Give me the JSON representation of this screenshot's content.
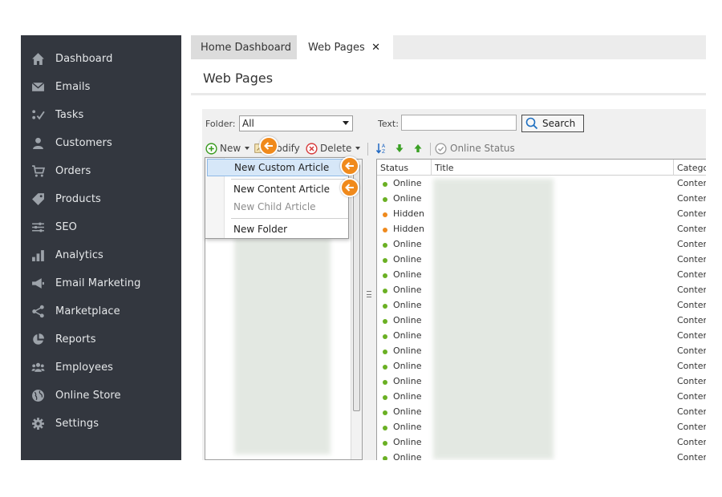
{
  "sidebar": {
    "items": [
      {
        "label": "Dashboard",
        "icon": "home-icon"
      },
      {
        "label": "Emails",
        "icon": "envelope-icon"
      },
      {
        "label": "Tasks",
        "icon": "tasks-icon"
      },
      {
        "label": "Customers",
        "icon": "user-icon"
      },
      {
        "label": "Orders",
        "icon": "cart-icon"
      },
      {
        "label": "Products",
        "icon": "tag-icon"
      },
      {
        "label": "SEO",
        "icon": "sliders-icon"
      },
      {
        "label": "Analytics",
        "icon": "bar-chart-icon"
      },
      {
        "label": "Email Marketing",
        "icon": "megaphone-icon"
      },
      {
        "label": "Marketplace",
        "icon": "share-icon"
      },
      {
        "label": "Reports",
        "icon": "pie-chart-icon"
      },
      {
        "label": "Employees",
        "icon": "group-icon"
      },
      {
        "label": "Online Store",
        "icon": "globe-icon"
      },
      {
        "label": "Settings",
        "icon": "gear-icon"
      }
    ]
  },
  "tabs": [
    {
      "label": "Home Dashboard"
    },
    {
      "label": "Web Pages"
    }
  ],
  "page_title": "Web Pages",
  "filter": {
    "folder_label": "Folder:",
    "folder_value": "All",
    "text_label": "Text:",
    "text_value": "",
    "search_label": "Search"
  },
  "toolbar": {
    "new_label": "New",
    "modify_label": "Modify",
    "delete_label": "Delete",
    "online_status_label": "Online Status"
  },
  "new_menu": {
    "items": [
      "New Custom Article",
      "New Content Article",
      "New Child Article",
      "New Folder"
    ]
  },
  "grid": {
    "columns": [
      "Status",
      "Title",
      "Category"
    ],
    "rows": [
      {
        "status": "Online",
        "category": "Content"
      },
      {
        "status": "Online",
        "category": "Content"
      },
      {
        "status": "Hidden",
        "category": "Content"
      },
      {
        "status": "Hidden",
        "category": "Content"
      },
      {
        "status": "Online",
        "category": "Content"
      },
      {
        "status": "Online",
        "category": "Content"
      },
      {
        "status": "Online",
        "category": "Content"
      },
      {
        "status": "Online",
        "category": "Content"
      },
      {
        "status": "Online",
        "category": "Content"
      },
      {
        "status": "Online",
        "category": "Content"
      },
      {
        "status": "Online",
        "category": "Content"
      },
      {
        "status": "Online",
        "category": "Content"
      },
      {
        "status": "Online",
        "category": "Content"
      },
      {
        "status": "Online",
        "category": "Content"
      },
      {
        "status": "Online",
        "category": "Content"
      },
      {
        "status": "Online",
        "category": "Content"
      },
      {
        "status": "Online",
        "category": "Content"
      },
      {
        "status": "Online",
        "category": "Content"
      },
      {
        "status": "Online",
        "category": "Content"
      }
    ]
  },
  "colors": {
    "sidebar_bg": "#33373f",
    "online": "#6ab023",
    "hidden": "#ef8a1d",
    "callout": "#f08a1c",
    "menu_highlight": "#d6e7f8"
  }
}
